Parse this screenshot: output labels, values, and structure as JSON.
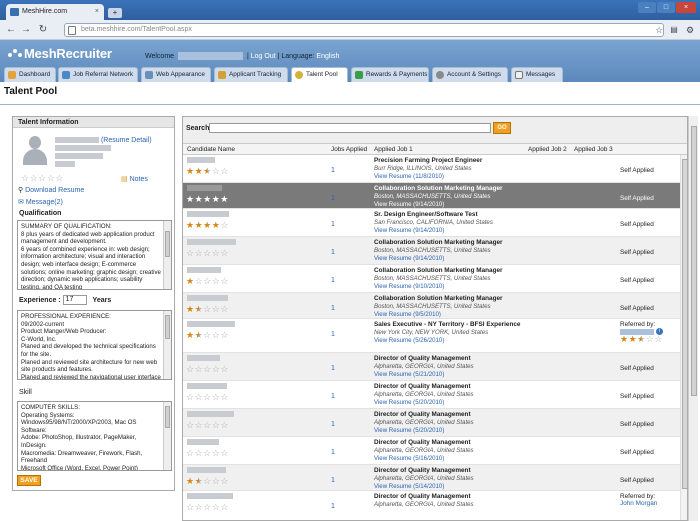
{
  "browser": {
    "tab_title": "MeshHire.com",
    "tab_close": "×",
    "new_tab": "+",
    "url": "beta.meshhire.com/TalentPool.aspx"
  },
  "header": {
    "logo": "MeshRecruiter",
    "welcome": "Welcome",
    "logout": "Log Out",
    "language_label": "| Language:",
    "language": "English",
    "separator": "|"
  },
  "nav_tabs": [
    {
      "label": "Dashboard"
    },
    {
      "label": "Job Referral Network"
    },
    {
      "label": "Web Appearance"
    },
    {
      "label": "Applicant Tracking"
    },
    {
      "label": "Talent Pool"
    },
    {
      "label": "Rewards & Payments"
    },
    {
      "label": "Account & Settings"
    },
    {
      "label": "Messages"
    }
  ],
  "page": {
    "title": "Talent Pool"
  },
  "talent_info": {
    "heading": "Talent Information",
    "resume_detail": "(Resume Detail)",
    "notes": "Notes",
    "download": "Download Resume",
    "message": "Message(2)",
    "qualification_label": "Qualification",
    "qualification_text": "SUMMARY OF QUALIFICATION:\n8 plus years of dedicated web application product management and development.\n6 years of combined experience in: web design; information architecture; visual and interaction design; web interface design; E-commerce solutions; online marketing; graphic design; creative direction; dynamic web applications; usability testing, and QA testing",
    "experience_label": "Experience :",
    "experience_value": "17",
    "experience_unit": "Years",
    "experience_text": "PROFESSIONAL EXPERIENCE:\n09/2002-current\nProduct Manger/Web Producer:\nC-World, Inc.\nPlaned and developed the technical specifications for the site.\nPlaned and reviewed site architecture for new web site products and features.\nPlaned and reviewed the navigational user interface",
    "skill_label": "Skill",
    "skill_text": "COMPUTER SKILLS:\nOperating Systems:\nWindows95/98/NT/2000/XP/2003, Mac OS\nSoftware:\nAdobe: PhotoShop, Illustrator, PageMaker, InDesign.\nMacromedia: Dreamweaver, Firework, Flash, Freehand\nMicrosoft Office (Word, Excel, Power Point)",
    "save": "SAVE",
    "rating": 0
  },
  "search": {
    "label": "Search:",
    "go": "GO"
  },
  "columns": {
    "name": "Candidate Name",
    "jobs": "Jobs Applied",
    "job1": "Applied Job 1",
    "job2": "Applied Job 2",
    "job3": "Applied Job 3"
  },
  "rows": [
    {
      "rating": 2.5,
      "jobs": "1",
      "job": "Precision Farming Project Engineer",
      "loc": "Burr Ridge, ILLINOIS, United States",
      "view": "View Resume (11/8/2010)",
      "status": "Self Applied",
      "style": ""
    },
    {
      "rating": 0,
      "jobs": "1",
      "job": "Collaboration Solution Marketing Manager",
      "loc": "Boston, MASSACHUSETTS, United States",
      "view": "View Resume (9/14/2010)",
      "status": "Self Applied",
      "style": "sel"
    },
    {
      "rating": 4,
      "jobs": "1",
      "job": "Sr. Design Engineer/Software Test",
      "loc": "San Francisco, CALIFORNIA, United States",
      "view": "View Resume (9/14/2010)",
      "status": "Self Applied",
      "style": ""
    },
    {
      "rating": 0,
      "jobs": "1",
      "job": "Collaboration Solution Marketing Manager",
      "loc": "Boston, MASSACHUSETTS, United States",
      "view": "View Resume (9/14/2010)",
      "status": "Self Applied",
      "style": "alt"
    },
    {
      "rating": 1,
      "jobs": "1",
      "job": "Collaboration Solution Marketing Manager",
      "loc": "Boston, MASSACHUSETTS, United States",
      "view": "View Resume (9/10/2010)",
      "status": "Self Applied",
      "style": ""
    },
    {
      "rating": 1.5,
      "jobs": "1",
      "job": "Collaboration Solution Marketing Manager",
      "loc": "Boston, MASSACHUSETTS, United States",
      "view": "View Resume (9/5/2010)",
      "status": "Self Applied",
      "style": "alt"
    },
    {
      "rating": 1.5,
      "jobs": "1",
      "job": "Sales Executive - NY Territory - BFSI Experience",
      "loc": "New York City, NEW YORK, United States",
      "view": "View Resume (5/26/2010)",
      "status": "",
      "referred": "Referred by:",
      "ref_rating": 2.5,
      "style": ""
    },
    {
      "rating": 0,
      "jobs": "1",
      "job": "Director of Quality Management",
      "loc": "Alpharetta, GEORGIA, United States",
      "view": "View Resume (5/21/2010)",
      "status": "Self Applied",
      "style": "alt"
    },
    {
      "rating": 0,
      "jobs": "1",
      "job": "Director of Quality Management",
      "loc": "Alpharetta, GEORGIA, United States",
      "view": "View Resume (5/20/2010)",
      "status": "Self Applied",
      "style": ""
    },
    {
      "rating": 0,
      "jobs": "1",
      "job": "Director of Quality Management",
      "loc": "Alpharetta, GEORGIA, United States",
      "view": "View Resume (5/20/2010)",
      "status": "Self Applied",
      "style": "alt"
    },
    {
      "rating": 0,
      "jobs": "1",
      "job": "Director of Quality Management",
      "loc": "Alpharetta, GEORGIA, United States",
      "view": "View Resume (5/16/2010)",
      "status": "Self Applied",
      "style": ""
    },
    {
      "rating": 1.5,
      "jobs": "1",
      "job": "Director of Quality Management",
      "loc": "Alpharetta, GEORGIA, United States",
      "view": "View Resume (5/14/2010)",
      "status": "Self Applied",
      "style": "alt"
    },
    {
      "rating": 0,
      "jobs": "1",
      "job": "Director of Quality Management",
      "loc": "Alpharetta, GEORGIA, United States",
      "view": "",
      "status": "",
      "referred": "Referred by:",
      "referrer": "John Morgan",
      "style": ""
    }
  ],
  "colors": {
    "accent": "#f0a020",
    "link": "#2b63b0",
    "header": "#5b89bd"
  }
}
